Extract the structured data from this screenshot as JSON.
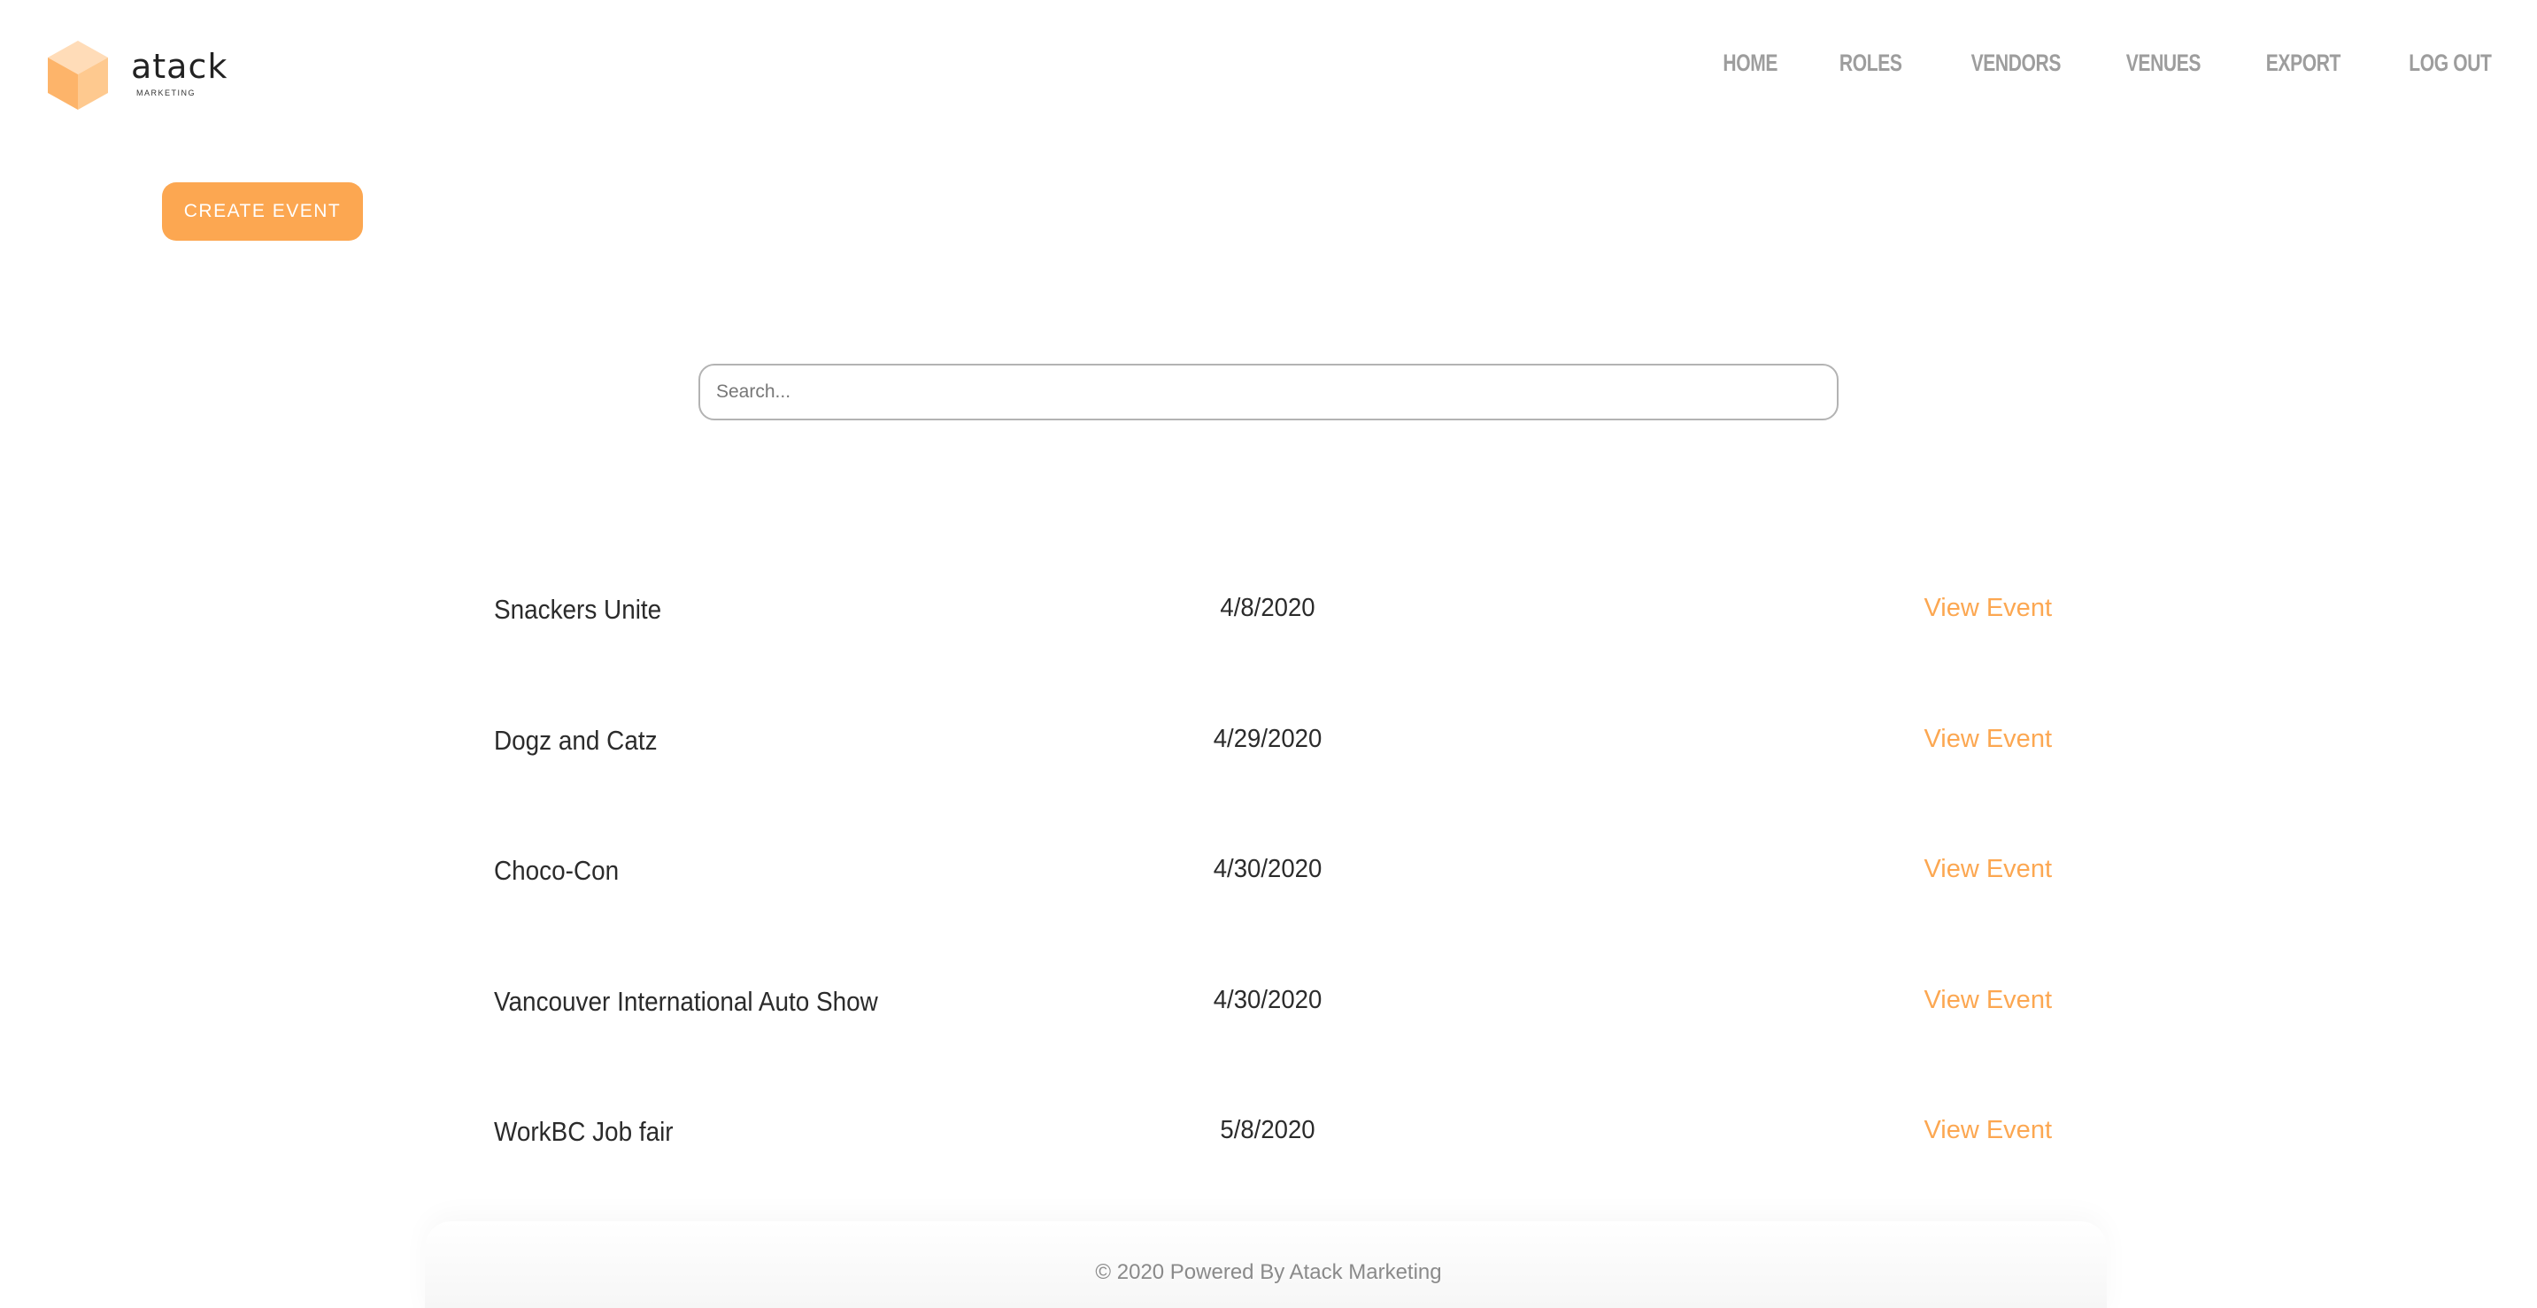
{
  "brand": {
    "name": "atack",
    "tagline": "MARKETING",
    "colors": {
      "accent": "#fca751",
      "cube_top": "#ffdcb8",
      "cube_left": "#fdb46a",
      "cube_right": "#fec98f"
    }
  },
  "nav": {
    "items": [
      {
        "label": "HOME"
      },
      {
        "label": "ROLES"
      },
      {
        "label": "VENDORS"
      },
      {
        "label": "VENUES"
      },
      {
        "label": "EXPORT"
      },
      {
        "label": "LOG OUT"
      }
    ]
  },
  "actions": {
    "create_event_label": "CREATE EVENT"
  },
  "search": {
    "placeholder": "Search...",
    "value": ""
  },
  "events": [
    {
      "name": "Snackers Unite",
      "date": "4/8/2020",
      "link_label": "View Event"
    },
    {
      "name": "Dogz and Catz",
      "date": "4/29/2020",
      "link_label": "View Event"
    },
    {
      "name": "Choco-Con",
      "date": "4/30/2020",
      "link_label": "View Event"
    },
    {
      "name": "Vancouver International Auto Show",
      "date": "4/30/2020",
      "link_label": "View Event"
    },
    {
      "name": "WorkBC Job fair",
      "date": "5/8/2020",
      "link_label": "View Event"
    }
  ],
  "footer": {
    "text": "© 2020 Powered By Atack Marketing"
  }
}
